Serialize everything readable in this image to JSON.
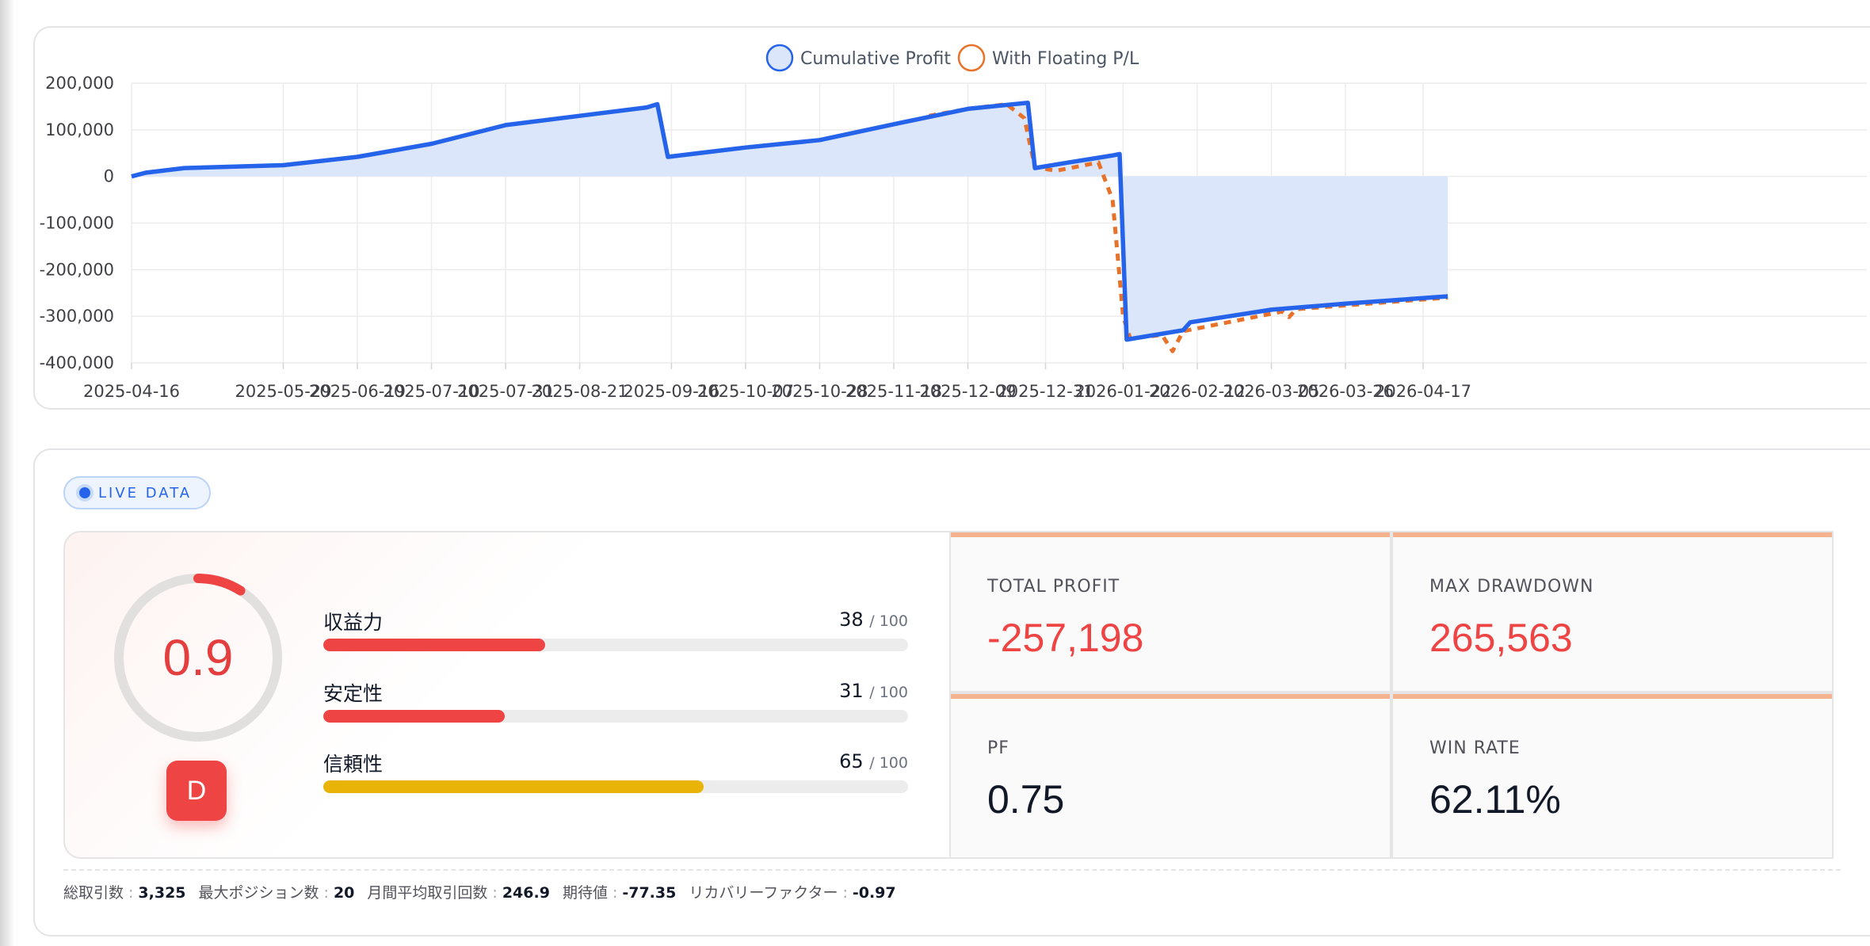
{
  "chart_data": {
    "type": "area",
    "series": [
      {
        "name": "Cumulative Profit",
        "color": "#2563eb",
        "fill": "#dbe6fb",
        "points": [
          [
            "2025-04-16",
            0
          ],
          [
            "2025-04-20",
            8000
          ],
          [
            "2025-05-01",
            18000
          ],
          [
            "2025-05-29",
            24000
          ],
          [
            "2025-06-19",
            42000
          ],
          [
            "2025-07-10",
            70000
          ],
          [
            "2025-07-31",
            110000
          ],
          [
            "2025-08-21",
            130000
          ],
          [
            "2025-09-09",
            148000
          ],
          [
            "2025-09-12",
            155000
          ],
          [
            "2025-09-15",
            42000
          ],
          [
            "2025-10-07",
            62000
          ],
          [
            "2025-10-28",
            78000
          ],
          [
            "2025-11-18",
            112000
          ],
          [
            "2025-12-09",
            145000
          ],
          [
            "2025-12-26",
            158000
          ],
          [
            "2025-12-28",
            18000
          ],
          [
            "2026-01-05",
            28000
          ],
          [
            "2026-01-19",
            45000
          ],
          [
            "2026-01-21",
            48000
          ],
          [
            "2026-01-23",
            -350000
          ],
          [
            "2026-02-08",
            -330000
          ],
          [
            "2026-02-10",
            -313000
          ],
          [
            "2026-03-05",
            -286000
          ],
          [
            "2026-03-26",
            -273000
          ],
          [
            "2026-04-24",
            -257198
          ]
        ]
      },
      {
        "name": "With Floating P/L",
        "color": "#e8722a",
        "points": [
          [
            "2025-11-28",
            130000
          ],
          [
            "2025-12-09",
            145000
          ],
          [
            "2025-12-20",
            155000
          ],
          [
            "2025-12-25",
            125000
          ],
          [
            "2025-12-28",
            20000
          ],
          [
            "2026-01-03",
            12000
          ],
          [
            "2026-01-15",
            30000
          ],
          [
            "2026-01-19",
            -50000
          ],
          [
            "2026-01-22",
            -300000
          ],
          [
            "2026-01-24",
            -348000
          ],
          [
            "2026-02-02",
            -340000
          ],
          [
            "2026-02-05",
            -375000
          ],
          [
            "2026-02-08",
            -332000
          ],
          [
            "2026-03-08",
            -290000
          ],
          [
            "2026-03-10",
            -302000
          ],
          [
            "2026-03-12",
            -285000
          ],
          [
            "2026-04-24",
            -260000
          ]
        ]
      }
    ],
    "ylim": [
      -400000,
      200000
    ],
    "yticks": [
      "200,000",
      "100,000",
      "0",
      "-100,000",
      "-200,000",
      "-300,000",
      "-400,000"
    ],
    "xticks": [
      "2025-04-16",
      "2025-05-29",
      "2025-06-19",
      "2025-07-10",
      "2025-07-31",
      "2025-08-21",
      "2025-09-16",
      "2025-10-07",
      "2025-10-28",
      "2025-11-18",
      "2025-12-09",
      "2025-12-31",
      "2026-01-22",
      "2026-02-12",
      "2026-03-05",
      "2026-03-26",
      "2026-04-17"
    ],
    "grid": true,
    "legend_position": "top-center"
  },
  "live_badge": "LIVE DATA",
  "score": {
    "value": "0.9",
    "fraction": 0.09,
    "grade": "D",
    "metrics": [
      {
        "label": "収益力",
        "score": "38",
        "max": "/ 100",
        "fraction": 0.38,
        "color": "#ef4444"
      },
      {
        "label": "安定性",
        "score": "31",
        "max": "/ 100",
        "fraction": 0.31,
        "color": "#ef4444"
      },
      {
        "label": "信頼性",
        "score": "65",
        "max": "/ 100",
        "fraction": 0.65,
        "color": "#eab308"
      }
    ]
  },
  "tiles": [
    {
      "label": "TOTAL PROFIT",
      "value": "-257,198",
      "color": "#ef4444"
    },
    {
      "label": "MAX DRAWDOWN",
      "value": "265,563",
      "color": "#ef4444"
    },
    {
      "label": "PF",
      "value": "0.75",
      "color": "#111827"
    },
    {
      "label": "WIN RATE",
      "value": "62.11%",
      "color": "#111827"
    }
  ],
  "footer": [
    {
      "label": "総取引数",
      "value": "3,325"
    },
    {
      "label": "最大ポジション数",
      "value": "20"
    },
    {
      "label": "月間平均取引回数",
      "value": "246.9"
    },
    {
      "label": "期待値",
      "value": "-77.35"
    },
    {
      "label": "リカバリーファクター",
      "value": "-0.97"
    }
  ]
}
